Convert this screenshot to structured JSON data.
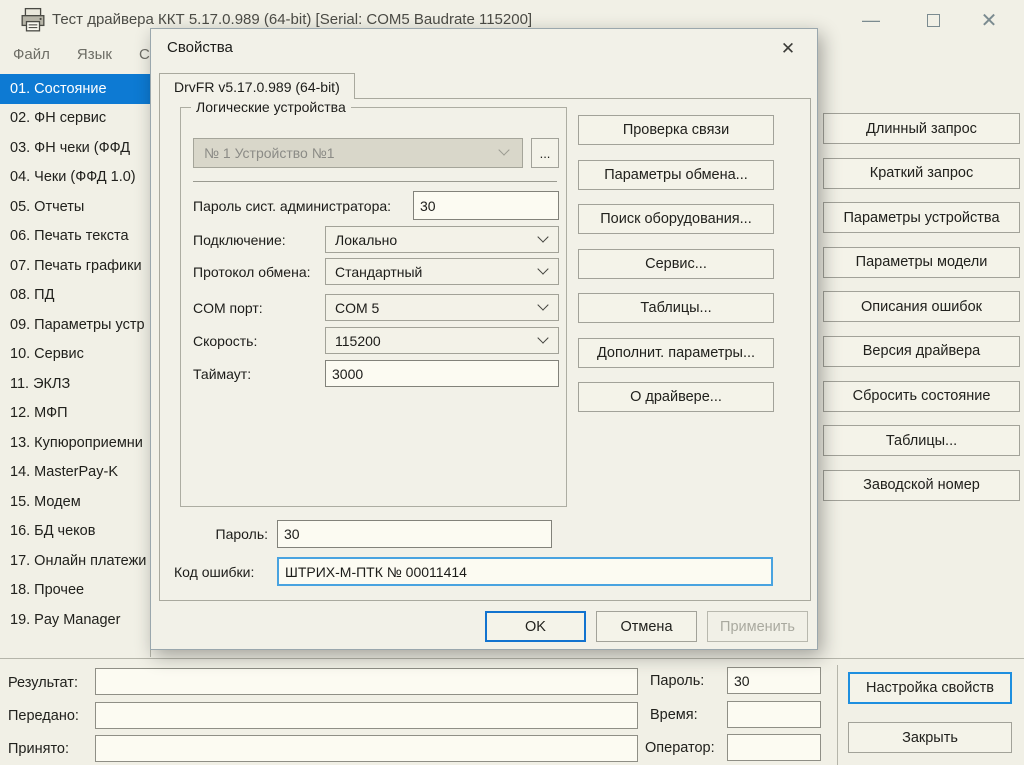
{
  "colors": {
    "selection_blue": "#0d7ad3",
    "default_button_border": "#1273cf",
    "focused_field_border": "#49a3e0",
    "settings_button_border": "#1e8fdf",
    "window_bg": "#f1f0e6"
  },
  "icons": {
    "minimize_glyph": "—",
    "close_glyph": "✕",
    "dialog_close_glyph": "✕"
  },
  "window": {
    "title": "Тест драйвера ККТ 5.17.0.989 (64-bit) [Serial: COM5 Baudrate 115200]",
    "menu": [
      {
        "label": "Файл"
      },
      {
        "label": "Язык"
      },
      {
        "label": "Спр"
      }
    ]
  },
  "sidebar": {
    "items": [
      {
        "label": "01. Состояние",
        "selected": true
      },
      {
        "label": "02. ФН сервис"
      },
      {
        "label": "03. ФН чеки (ФФД"
      },
      {
        "label": "04. Чеки (ФФД 1.0)"
      },
      {
        "label": "05. Отчеты"
      },
      {
        "label": "06. Печать текста"
      },
      {
        "label": "07. Печать графики"
      },
      {
        "label": "08. ПД"
      },
      {
        "label": "09. Параметры устр"
      },
      {
        "label": "10. Сервис"
      },
      {
        "label": "11. ЭКЛЗ"
      },
      {
        "label": "12. МФП"
      },
      {
        "label": "13. Купюроприемни"
      },
      {
        "label": "14. MasterPay-K"
      },
      {
        "label": "15. Модем"
      },
      {
        "label": "16. БД чеков"
      },
      {
        "label": "17. Онлайн платежи"
      },
      {
        "label": "18. Прочее"
      },
      {
        "label": "19. Pay Manager"
      }
    ]
  },
  "main_buttons": [
    "Длинный запрос",
    "Краткий запрос",
    "Параметры устройства",
    "Параметры модели",
    "Описания ошибок",
    "Версия драйвера",
    "Сбросить состояние",
    "Таблицы...",
    "Заводской номер"
  ],
  "status_panel": {
    "left_fields": [
      {
        "label": "Результат:",
        "value": ""
      },
      {
        "label": "Передано:",
        "value": ""
      },
      {
        "label": "Принято:",
        "value": ""
      }
    ],
    "right_fields": [
      {
        "label": "Пароль:",
        "value": "30"
      },
      {
        "label": "Время:",
        "value": ""
      },
      {
        "label": "Оператор:",
        "value": ""
      }
    ],
    "settings_button": "Настройка свойств",
    "close_button": "Закрыть"
  },
  "dialog": {
    "title": "Свойства",
    "tab_label": "DrvFR v5.17.0.989 (64-bit)",
    "devices_group": {
      "title": "Логические устройства",
      "device_value": "№ 1 Устройство №1",
      "browse_label": "...",
      "fields": [
        {
          "label": "Пароль сист. администратора:",
          "value": "30",
          "control": "input"
        },
        {
          "label": "Подключение:",
          "value": "Локально",
          "control": "combo"
        },
        {
          "label": "Протокол обмена:",
          "value": "Стандартный",
          "control": "combo"
        },
        {
          "label": "COM порт:",
          "value": "COM 5",
          "control": "combo"
        },
        {
          "label": "Скорость:",
          "value": "115200",
          "control": "combo"
        },
        {
          "label": "Таймаут:",
          "value": "3000",
          "control": "input"
        }
      ]
    },
    "action_buttons": [
      "Проверка связи",
      "Параметры обмена...",
      "Поиск оборудования...",
      "Сервис...",
      "Таблицы...",
      "Дополнит. параметры...",
      "О драйвере..."
    ],
    "password_field": {
      "label": "Пароль:",
      "value": "30"
    },
    "error_field": {
      "label": "Код ошибки:",
      "value": "ШТРИХ-М-ПТК № 00011414"
    },
    "footer": {
      "ok": "OK",
      "cancel": "Отмена",
      "apply": "Применить"
    }
  }
}
